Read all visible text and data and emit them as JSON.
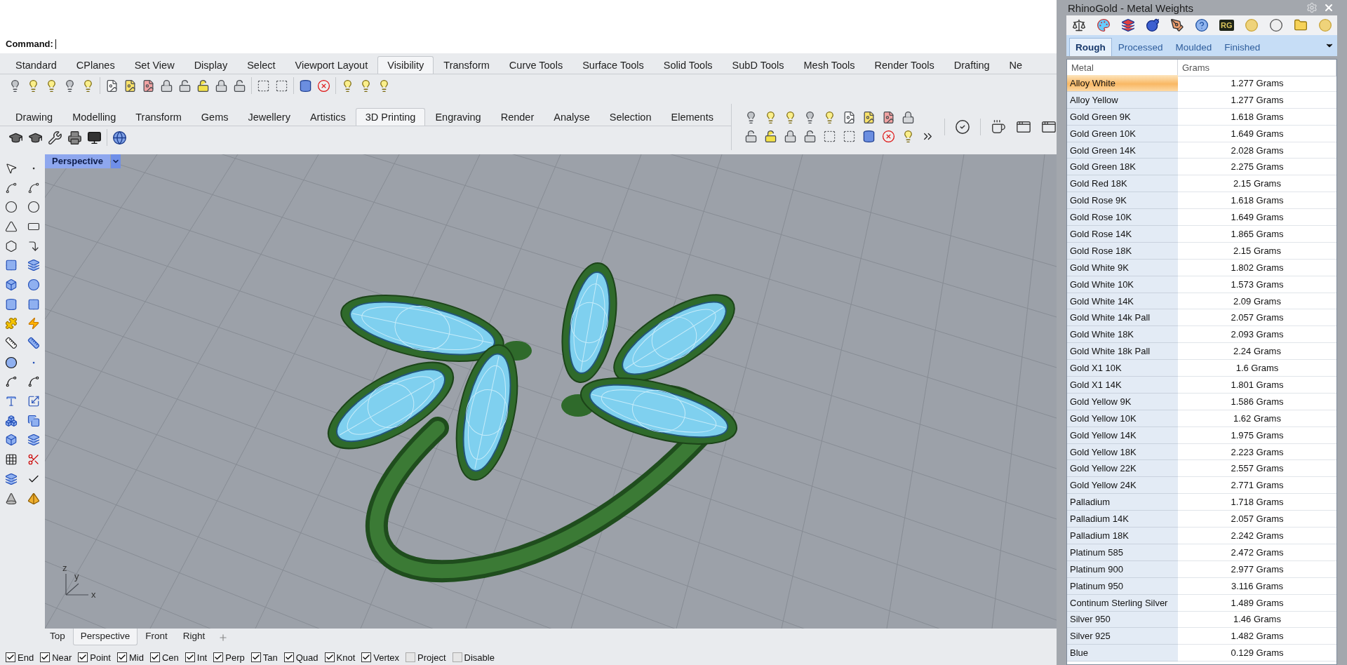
{
  "command_line": {
    "prompt": "Command:"
  },
  "toolbar_tabs": [
    {
      "label": "Standard",
      "selected": false
    },
    {
      "label": "CPlanes",
      "selected": false
    },
    {
      "label": "Set View",
      "selected": false
    },
    {
      "label": "Display",
      "selected": false
    },
    {
      "label": "Select",
      "selected": false
    },
    {
      "label": "Viewport Layout",
      "selected": false
    },
    {
      "label": "Visibility",
      "selected": true
    },
    {
      "label": "Transform",
      "selected": false
    },
    {
      "label": "Curve Tools",
      "selected": false
    },
    {
      "label": "Surface Tools",
      "selected": false
    },
    {
      "label": "Solid Tools",
      "selected": false
    },
    {
      "label": "SubD Tools",
      "selected": false
    },
    {
      "label": "Mesh Tools",
      "selected": false
    },
    {
      "label": "Render Tools",
      "selected": false
    },
    {
      "label": "Drafting",
      "selected": false
    },
    {
      "label": "Ne",
      "selected": false
    }
  ],
  "plugin_tabs": [
    {
      "label": "Drawing",
      "selected": false
    },
    {
      "label": "Modelling",
      "selected": false
    },
    {
      "label": "Transform",
      "selected": false
    },
    {
      "label": "Gems",
      "selected": false
    },
    {
      "label": "Jewellery",
      "selected": false
    },
    {
      "label": "Artistics",
      "selected": false
    },
    {
      "label": "3D Printing",
      "selected": true
    },
    {
      "label": "Engraving",
      "selected": false
    },
    {
      "label": "Render",
      "selected": false
    },
    {
      "label": "Analyse",
      "selected": false
    },
    {
      "label": "Selection",
      "selected": false
    },
    {
      "label": "Elements",
      "selected": false
    }
  ],
  "viewport": {
    "title": "Perspective",
    "axes": [
      "x",
      "y",
      "z"
    ]
  },
  "viewport_tabs": [
    {
      "label": "Top",
      "selected": false
    },
    {
      "label": "Perspective",
      "selected": true
    },
    {
      "label": "Front",
      "selected": false
    },
    {
      "label": "Right",
      "selected": false
    }
  ],
  "osnaps": [
    {
      "label": "End",
      "checked": true
    },
    {
      "label": "Near",
      "checked": true
    },
    {
      "label": "Point",
      "checked": true
    },
    {
      "label": "Mid",
      "checked": true
    },
    {
      "label": "Cen",
      "checked": true
    },
    {
      "label": "Int",
      "checked": true
    },
    {
      "label": "Perp",
      "checked": true
    },
    {
      "label": "Tan",
      "checked": true
    },
    {
      "label": "Quad",
      "checked": true
    },
    {
      "label": "Knot",
      "checked": true
    },
    {
      "label": "Vertex",
      "checked": true
    },
    {
      "label": "Project",
      "checked": false
    },
    {
      "label": "Disable",
      "checked": false
    }
  ],
  "metal_weights": {
    "title": "RhinoGold - Metal Weights",
    "logo": "RG",
    "tabs": [
      {
        "label": "Rough",
        "selected": true
      },
      {
        "label": "Processed",
        "selected": false
      },
      {
        "label": "Moulded",
        "selected": false
      },
      {
        "label": "Finished",
        "selected": false
      }
    ],
    "columns": [
      "Metal",
      "Grams"
    ],
    "rows": [
      {
        "metal": "Alloy White",
        "grams": "1.277 Grams",
        "selected": true
      },
      {
        "metal": "Alloy Yellow",
        "grams": "1.277 Grams",
        "selected": false
      },
      {
        "metal": "Gold Green 9K",
        "grams": "1.618 Grams",
        "selected": false
      },
      {
        "metal": "Gold Green 10K",
        "grams": "1.649 Grams",
        "selected": false
      },
      {
        "metal": "Gold Green 14K",
        "grams": "2.028 Grams",
        "selected": false
      },
      {
        "metal": "Gold Green 18K",
        "grams": "2.275 Grams",
        "selected": false
      },
      {
        "metal": "Gold Red 18K",
        "grams": "2.15 Grams",
        "selected": false
      },
      {
        "metal": "Gold Rose 9K",
        "grams": "1.618 Grams",
        "selected": false
      },
      {
        "metal": "Gold Rose 10K",
        "grams": "1.649 Grams",
        "selected": false
      },
      {
        "metal": "Gold Rose 14K",
        "grams": "1.865 Grams",
        "selected": false
      },
      {
        "metal": "Gold Rose 18K",
        "grams": "2.15 Grams",
        "selected": false
      },
      {
        "metal": "Gold White 9K",
        "grams": "1.802 Grams",
        "selected": false
      },
      {
        "metal": "Gold White 10K",
        "grams": "1.573 Grams",
        "selected": false
      },
      {
        "metal": "Gold White 14K",
        "grams": "2.09 Grams",
        "selected": false
      },
      {
        "metal": "Gold White 14k Pall",
        "grams": "2.057 Grams",
        "selected": false
      },
      {
        "metal": "Gold White 18K",
        "grams": "2.093 Grams",
        "selected": false
      },
      {
        "metal": "Gold White 18k Pall",
        "grams": "2.24 Grams",
        "selected": false
      },
      {
        "metal": "Gold X1 10K",
        "grams": "1.6 Grams",
        "selected": false
      },
      {
        "metal": "Gold X1 14K",
        "grams": "1.801 Grams",
        "selected": false
      },
      {
        "metal": "Gold Yellow 9K",
        "grams": "1.586 Grams",
        "selected": false
      },
      {
        "metal": "Gold Yellow 10K",
        "grams": "1.62 Grams",
        "selected": false
      },
      {
        "metal": "Gold Yellow 14K",
        "grams": "1.975 Grams",
        "selected": false
      },
      {
        "metal": "Gold Yellow 18K",
        "grams": "2.223 Grams",
        "selected": false
      },
      {
        "metal": "Gold Yellow 22K",
        "grams": "2.557 Grams",
        "selected": false
      },
      {
        "metal": "Gold Yellow 24K",
        "grams": "2.771 Grams",
        "selected": false
      },
      {
        "metal": "Palladium",
        "grams": "1.718 Grams",
        "selected": false
      },
      {
        "metal": "Palladium 14K",
        "grams": "2.057 Grams",
        "selected": false
      },
      {
        "metal": "Palladium 18K",
        "grams": "2.242 Grams",
        "selected": false
      },
      {
        "metal": "Platinum 585",
        "grams": "2.472 Grams",
        "selected": false
      },
      {
        "metal": "Platinum 900",
        "grams": "2.977 Grams",
        "selected": false
      },
      {
        "metal": "Platinum 950",
        "grams": "3.116 Grams",
        "selected": false
      },
      {
        "metal": "Continum Sterling Silver",
        "grams": "1.489 Grams",
        "selected": false
      },
      {
        "metal": "Silver 950",
        "grams": "1.46 Grams",
        "selected": false
      },
      {
        "metal": "Silver 925",
        "grams": "1.482 Grams",
        "selected": false
      },
      {
        "metal": "Blue",
        "grams": "0.129 Grams",
        "selected": false
      }
    ]
  }
}
